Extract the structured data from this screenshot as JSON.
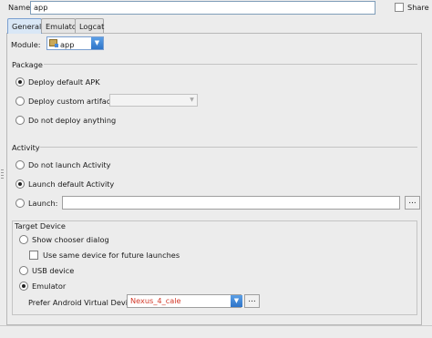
{
  "name_label": "Name:",
  "name_value": "app",
  "share_label": "Share",
  "tabs": [
    "General",
    "Emulator",
    "Logcat"
  ],
  "module": {
    "label": "Module:",
    "value": "app"
  },
  "package": {
    "title": "Package",
    "deploy_default": "Deploy default APK",
    "deploy_custom": "Deploy custom artifact:",
    "no_deploy": "Do not deploy anything"
  },
  "activity": {
    "title": "Activity",
    "no_launch": "Do not launch Activity",
    "launch_default": "Launch default Activity",
    "launch": "Launch:",
    "browse": "..."
  },
  "target": {
    "title": "Target Device",
    "chooser": "Show chooser dialog",
    "same_device": "Use same device for future launches",
    "usb": "USB device",
    "emulator": "Emulator",
    "avd_label": "Prefer Android Virtual Device:",
    "avd_value": "Nexus_4_cale",
    "browse": "..."
  },
  "colors": {
    "accent": "#3b82d6",
    "error_text": "#d33a2a",
    "tab_active": "#d9e7f6"
  }
}
